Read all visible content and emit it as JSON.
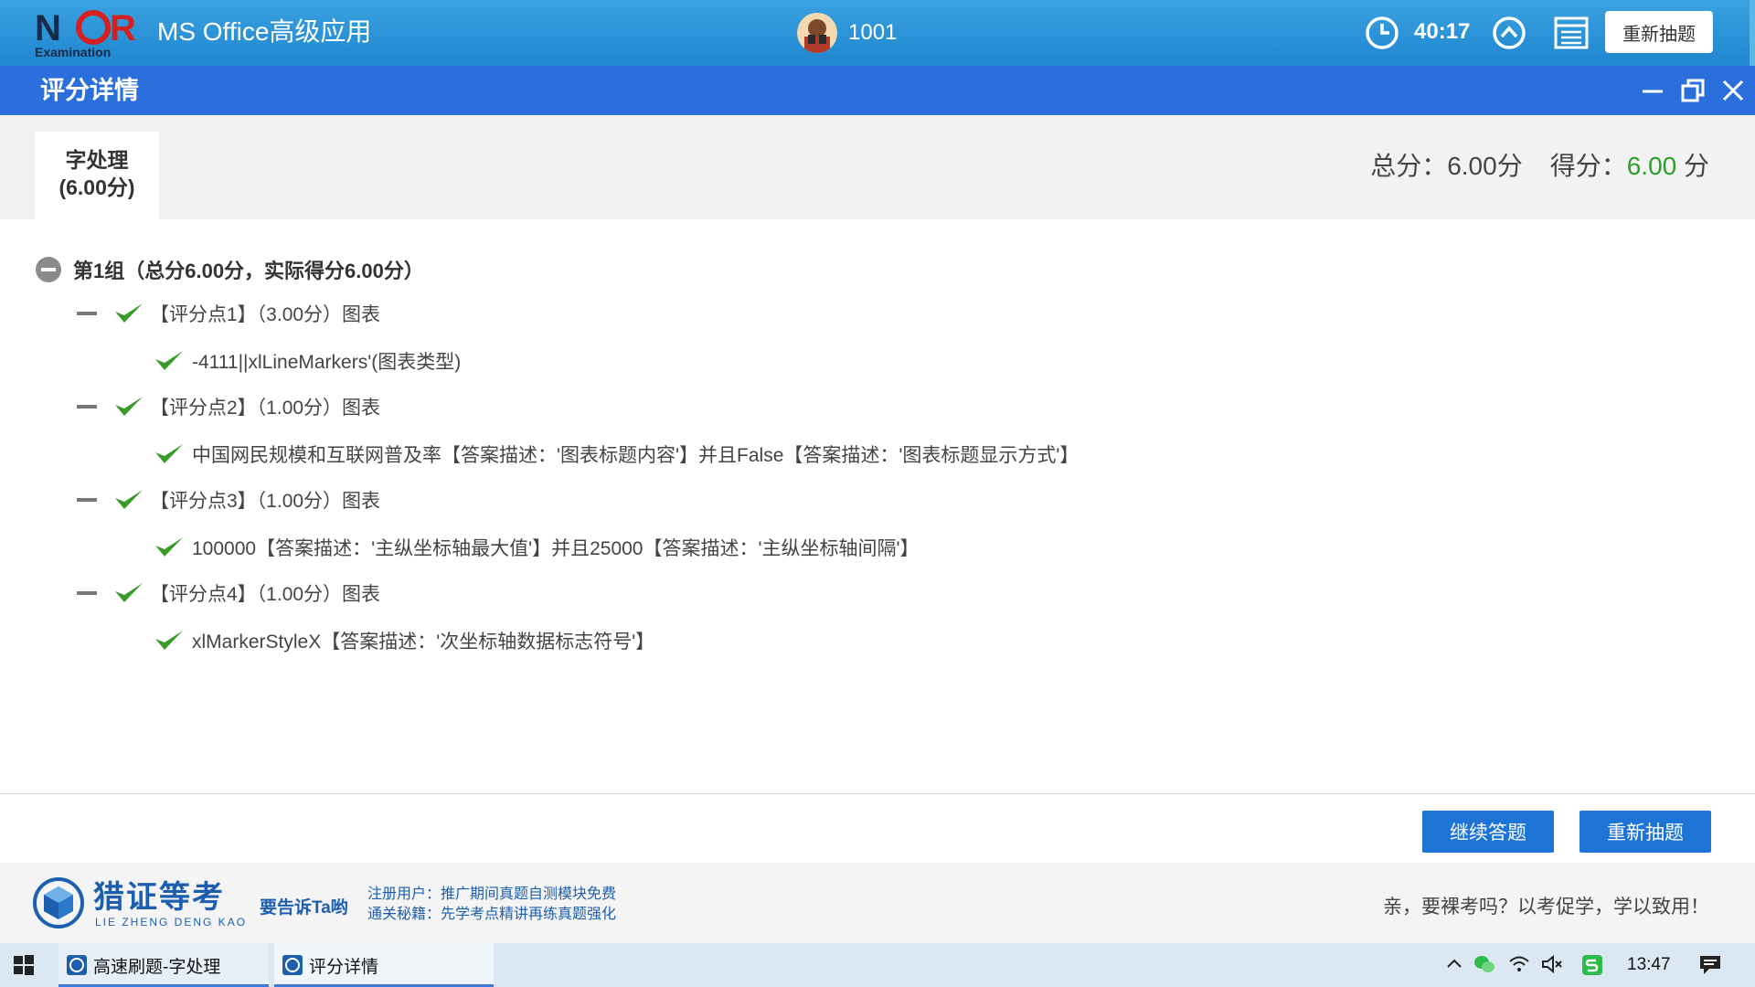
{
  "header": {
    "logo_text_top": "NCR",
    "logo_text_bottom": "Examination",
    "app_title": "MS Office高级应用",
    "user_id": "1001",
    "timer": "40:17",
    "redraw_label": "重新抽题"
  },
  "dialog": {
    "title": "评分详情"
  },
  "summary": {
    "tab_name": "字处理",
    "tab_score": "(6.00分)",
    "total_label": "总分：",
    "total_value": "6.00分",
    "got_label": "得分：",
    "got_value": "6.00",
    "got_unit": " 分"
  },
  "group": {
    "label": "第1组（总分6.00分，实际得分6.00分）"
  },
  "points": [
    {
      "label": "【评分点1】（3.00分）图表",
      "detail": "-4111||xlLineMarkers'(图表类型)"
    },
    {
      "label": "【评分点2】（1.00分）图表",
      "detail": "中国网民规模和互联网普及率【答案描述：'图表标题内容'】并且False【答案描述：'图表标题显示方式'】"
    },
    {
      "label": "【评分点3】（1.00分）图表",
      "detail": "100000【答案描述：'主纵坐标轴最大值'】并且25000【答案描述：'主纵坐标轴间隔'】"
    },
    {
      "label": "【评分点4】（1.00分）图表",
      "detail": "xlMarkerStyleX【答案描述：'次坐标轴数据标志符号'】"
    }
  ],
  "actions": {
    "continue_label": "继续答题",
    "redraw_label": "重新抽题"
  },
  "brand": {
    "name": "猎证等考",
    "pinyin": "LIE ZHENG DENG KAO",
    "tell": "要告诉Ta哟",
    "promo_line1": "注册用户：推广期间真题自测模块免费",
    "promo_line2": "通关秘籍：先学考点精讲再练真题强化",
    "slogan": "亲，要裸考吗？以考促学，学以致用！"
  },
  "taskbar": {
    "items": [
      {
        "label": "高速刷题-字处理"
      },
      {
        "label": "评分详情"
      }
    ],
    "time": "13:47"
  },
  "colors": {
    "header_blue": "#2a8fd6",
    "dialog_blue": "#2a6fdc",
    "button_blue": "#1e74d6",
    "pass_green": "#2ca02c",
    "check_green": "#3a9a2a"
  }
}
